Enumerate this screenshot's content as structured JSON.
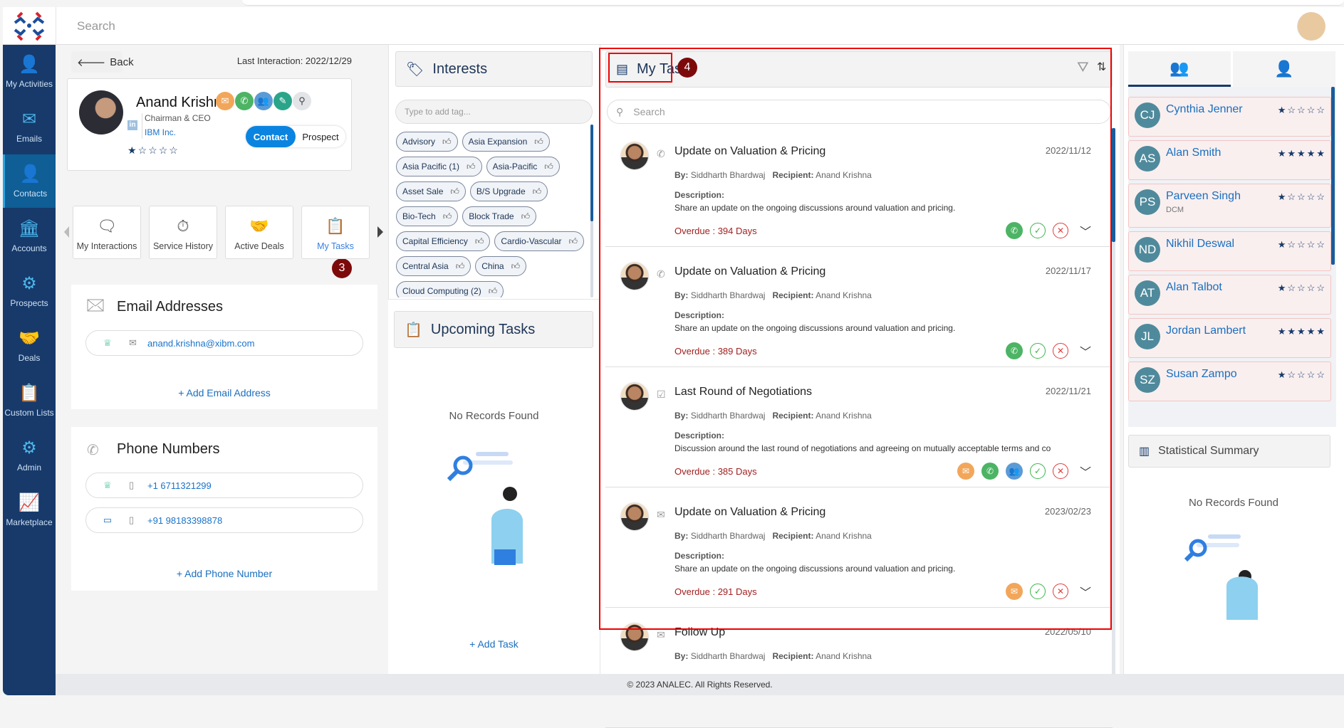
{
  "header": {
    "search_placeholder": "Search"
  },
  "sidebar": {
    "items": [
      {
        "label": "My Activities",
        "icon": "user-check-icon"
      },
      {
        "label": "Emails",
        "icon": "envelope-icon"
      },
      {
        "label": "Contacts",
        "icon": "user-icon",
        "active": true
      },
      {
        "label": "Accounts",
        "icon": "bank-icon"
      },
      {
        "label": "Prospects",
        "icon": "chart-gear-icon"
      },
      {
        "label": "Deals",
        "icon": "handshake-icon"
      },
      {
        "label": "Custom Lists",
        "icon": "clipboard-list-icon"
      },
      {
        "label": "Admin",
        "icon": "user-gear-icon"
      },
      {
        "label": "Marketplace",
        "icon": "growth-icon"
      }
    ]
  },
  "contact": {
    "back_label": "Back",
    "last_interaction": "Last Interaction: 2022/12/29",
    "name": "Anand Krishna",
    "title": "Chairman & CEO",
    "company": "IBM Inc.",
    "linkedin": "in",
    "rating": 1,
    "type_options": [
      "Contact",
      "Prospect"
    ],
    "type_selected": "Contact",
    "quick_actions": [
      {
        "icon": "email-icon",
        "color": "#f2a65a"
      },
      {
        "icon": "phone-icon",
        "color": "#4cb464"
      },
      {
        "icon": "meeting-icon",
        "color": "#5b9bd5"
      },
      {
        "icon": "note-icon",
        "color": "#2aa58a"
      },
      {
        "icon": "search-icon",
        "color": "#e2e4e8"
      }
    ]
  },
  "tiles": [
    {
      "label": "My Interactions"
    },
    {
      "label": "Service History"
    },
    {
      "label": "Active Deals"
    },
    {
      "label": "My Tasks",
      "active": true
    }
  ],
  "annotations": {
    "step3": "3",
    "step4": "4"
  },
  "emails": {
    "title": "Email Addresses",
    "items": [
      "anand.krishna@xibm.com"
    ],
    "add_label": "+ Add Email Address"
  },
  "phones": {
    "title": "Phone Numbers",
    "items": [
      {
        "number": "+1 6711321299",
        "kind": "crown-icon"
      },
      {
        "number": "+91 98183398878",
        "kind": "briefcase-icon"
      }
    ],
    "add_label": "+ Add Phone Number"
  },
  "interests": {
    "title": "Interests",
    "placeholder": "Type to add tag...",
    "tags": [
      "Advisory",
      "Asia Expansion",
      "Asia Pacific (1)",
      "Asia-Pacific",
      "Asset Sale",
      "B/S Upgrade",
      "Bio-Tech",
      "Block Trade",
      "Capital Efficiency",
      "Cardio-Vascular",
      "Central Asia",
      "China",
      "Cloud Computing (2)"
    ]
  },
  "upcoming": {
    "title": "Upcoming Tasks",
    "empty": "No Records Found",
    "add_label": "+ Add Task"
  },
  "tasks": {
    "title": "My Tasks",
    "search_placeholder": "Search",
    "by_label": "By:",
    "recipient_label": "Recipient:",
    "desc_label": "Description:",
    "items": [
      {
        "type": "phone",
        "title": "Update on Valuation & Pricing",
        "date": "2022/11/12",
        "by": "Siddharth Bhardwaj",
        "recipient": "Anand Krishna",
        "description": "Share an update on the ongoing discussions around valuation and pricing.",
        "overdue": "Overdue : 394 Days",
        "actions": [
          "phone"
        ]
      },
      {
        "type": "phone",
        "title": "Update on Valuation & Pricing",
        "date": "2022/11/17",
        "by": "Siddharth Bhardwaj",
        "recipient": "Anand Krishna",
        "description": "Share an update on the ongoing discussions around valuation and pricing.",
        "overdue": "Overdue : 389 Days",
        "actions": [
          "phone"
        ]
      },
      {
        "type": "task",
        "title": "Last Round of Negotiations",
        "date": "2022/11/21",
        "by": "Siddharth Bhardwaj",
        "recipient": "Anand Krishna",
        "description": "Discussion around the last round of negotiations and agreeing on mutually acceptable terms and co",
        "overdue": "Overdue : 385 Days",
        "actions": [
          "email",
          "phone",
          "meeting"
        ]
      },
      {
        "type": "email",
        "title": "Update on Valuation & Pricing",
        "date": "2023/02/23",
        "by": "Siddharth Bhardwaj",
        "recipient": "Anand Krishna",
        "description": "Share an update on the ongoing discussions around valuation and pricing.",
        "overdue": "Overdue : 291 Days",
        "actions": [
          "email"
        ]
      },
      {
        "type": "email",
        "title": "Follow Up",
        "date": "2022/05/10",
        "by": "Siddharth Bhardwaj",
        "recipient": "Anand Krishna",
        "description": "",
        "overdue": "",
        "actions": []
      }
    ]
  },
  "related": {
    "contacts": [
      {
        "initials": "CJ",
        "name": "Cynthia Jenner",
        "sub": "",
        "rating": 1
      },
      {
        "initials": "AS",
        "name": "Alan Smith",
        "sub": "",
        "rating": 5
      },
      {
        "initials": "PS",
        "name": "Parveen Singh",
        "sub": "DCM",
        "rating": 1
      },
      {
        "initials": "ND",
        "name": "Nikhil Deswal",
        "sub": "",
        "rating": 1
      },
      {
        "initials": "AT",
        "name": "Alan Talbot",
        "sub": "",
        "rating": 1
      },
      {
        "initials": "JL",
        "name": "Jordan Lambert",
        "sub": "",
        "rating": 5
      },
      {
        "initials": "SZ",
        "name": "Susan Zampo",
        "sub": "",
        "rating": 1
      }
    ],
    "stats_title": "Statistical Summary",
    "stats_empty": "No Records Found"
  },
  "footer": {
    "copyright": "© 2023 ANALEC. All Rights Reserved."
  }
}
